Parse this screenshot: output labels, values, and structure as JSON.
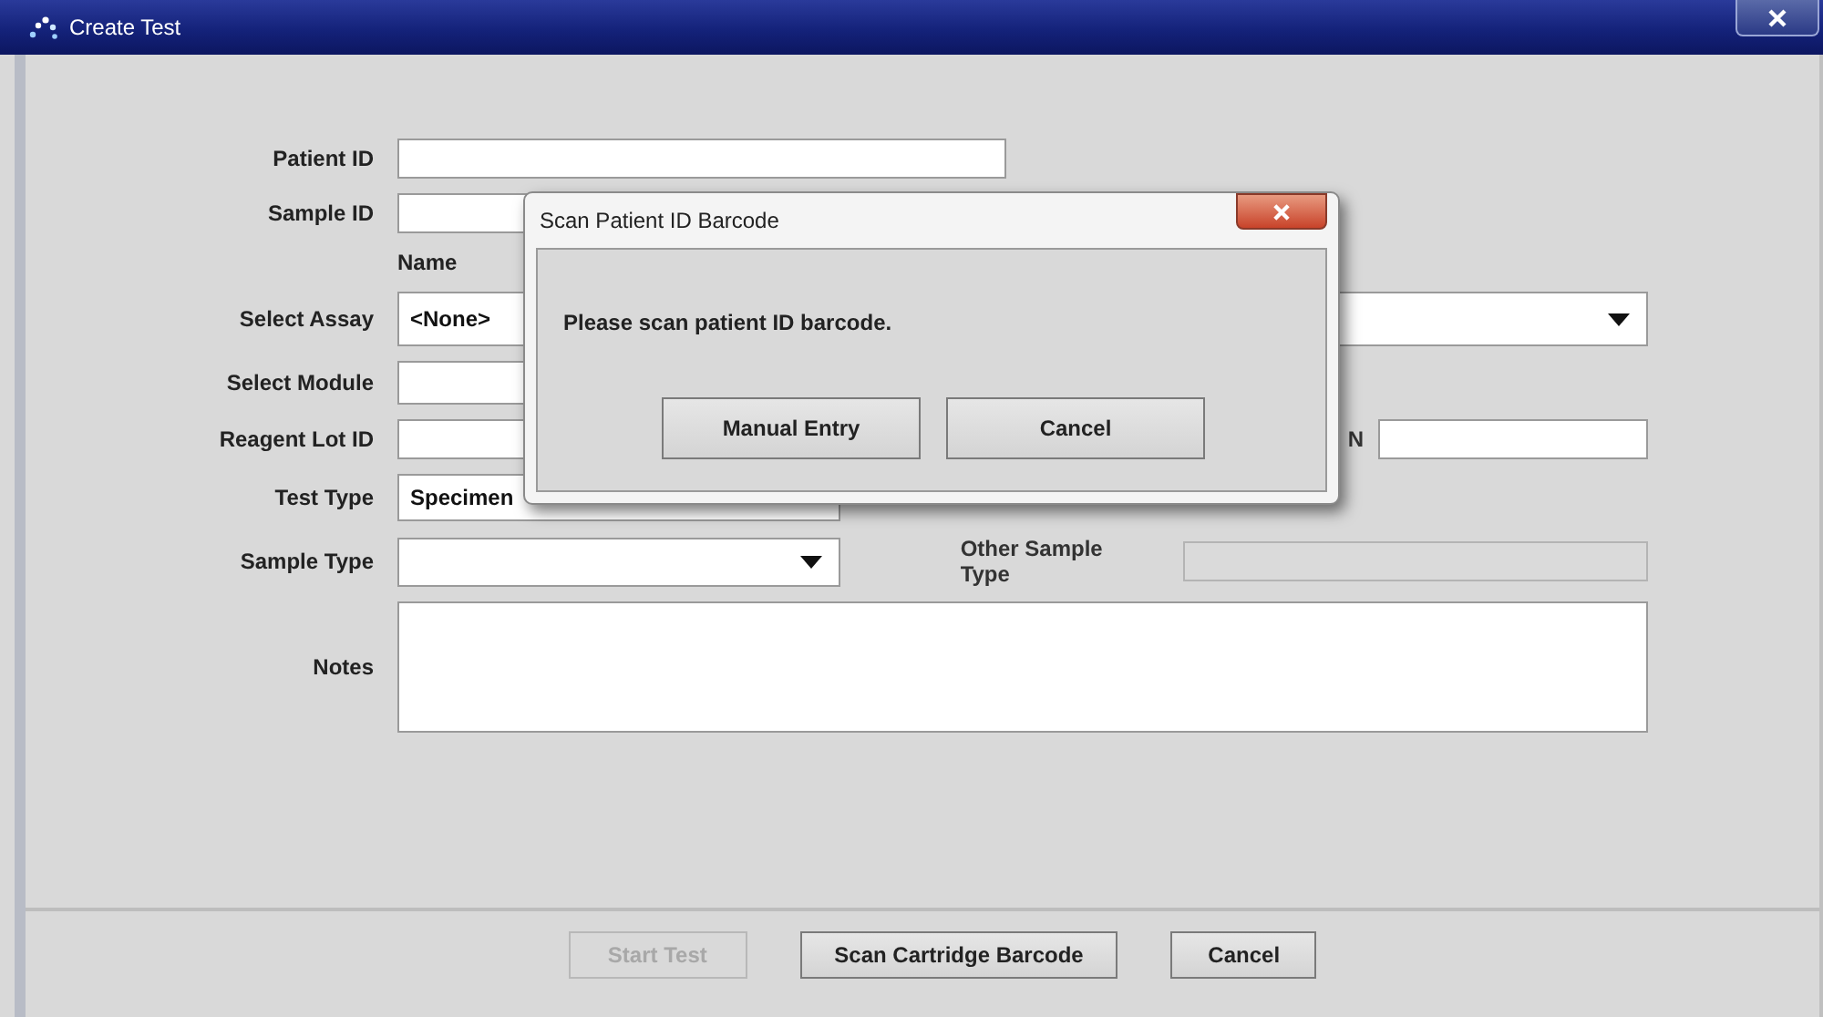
{
  "window": {
    "title": "Create Test"
  },
  "form": {
    "rows": [
      {
        "kind": "text",
        "label": "Patient ID"
      },
      {
        "kind": "text",
        "label": "Sample ID"
      },
      {
        "kind": "header",
        "text": "Name"
      },
      {
        "kind": "combo",
        "label": "Select Assay",
        "value": "<None>"
      },
      {
        "kind": "text",
        "label": "Select Module"
      },
      {
        "kind": "text",
        "label": "Reagent Lot ID",
        "extra": {
          "label": "N",
          "disabled": false
        }
      },
      {
        "kind": "text",
        "label": "Test Type",
        "value": "Specimen"
      },
      {
        "kind": "combo",
        "label": "Sample Type",
        "extra": {
          "label": "Other Sample Type",
          "disabled": true
        }
      },
      {
        "kind": "textarea",
        "label": "Notes"
      }
    ]
  },
  "buttons": [
    {
      "label": "Start Test",
      "disabled": true
    },
    {
      "label": "Scan Cartridge Barcode",
      "disabled": false
    },
    {
      "label": "Cancel",
      "disabled": false
    }
  ],
  "dialog": {
    "title": "Scan Patient ID Barcode",
    "message": "Please scan patient ID barcode.",
    "buttons": [
      {
        "label": "Manual Entry"
      },
      {
        "label": "Cancel"
      }
    ]
  }
}
